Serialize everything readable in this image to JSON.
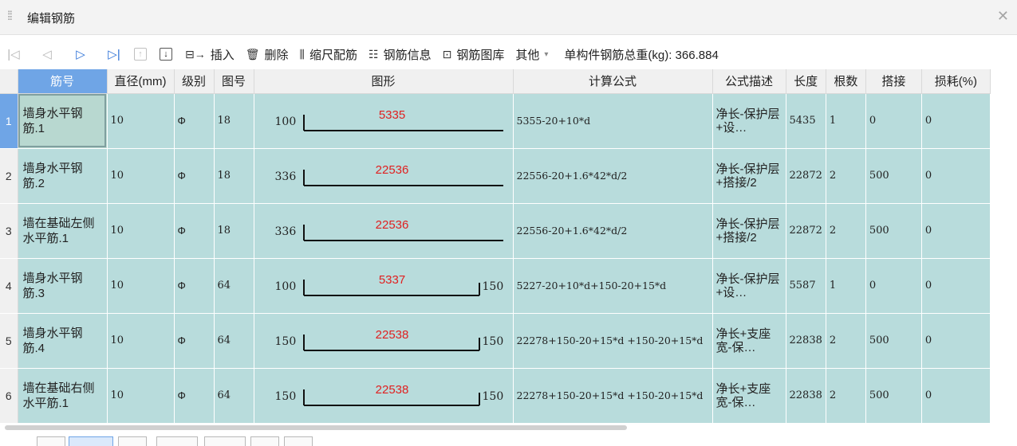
{
  "window": {
    "title": "编辑钢筋"
  },
  "toolbar": {
    "insert_label": "插入",
    "delete_label": "删除",
    "scale_label": "缩尺配筋",
    "info_label": "钢筋信息",
    "library_label": "钢筋图库",
    "other_label": "其他",
    "weight_label": "单构件钢筋总重(kg): 366.884"
  },
  "headers": [
    "筋号",
    "直径(mm)",
    "级别",
    "图号",
    "图形",
    "计算公式",
    "公式描述",
    "长度",
    "根数",
    "搭接",
    "损耗(%)"
  ],
  "steel_grade_symbol": "Ф",
  "rows": [
    {
      "index": "1",
      "name": "墙身水平钢筋.1",
      "dia": "10",
      "fig": "18",
      "shape": "L",
      "left": "100",
      "length": "5335",
      "right": "",
      "formula": "5355-20+10*d",
      "desc": "净长-保护层+设…",
      "len": "5435",
      "count": "1",
      "lap": "0",
      "loss": "0"
    },
    {
      "index": "2",
      "name": "墙身水平钢筋.2",
      "dia": "10",
      "fig": "18",
      "shape": "L",
      "left": "336",
      "length": "22536",
      "right": "",
      "formula": "22556-20+1.6*42*d/2",
      "desc": "净长-保护层+搭接/2",
      "len": "22872",
      "count": "2",
      "lap": "500",
      "loss": "0"
    },
    {
      "index": "3",
      "name": "墙在基础左侧水平筋.1",
      "dia": "10",
      "fig": "18",
      "shape": "L",
      "left": "336",
      "length": "22536",
      "right": "",
      "formula": "22556-20+1.6*42*d/2",
      "desc": "净长-保护层+搭接/2",
      "len": "22872",
      "count": "2",
      "lap": "500",
      "loss": "0"
    },
    {
      "index": "4",
      "name": "墙身水平钢筋.3",
      "dia": "10",
      "fig": "64",
      "shape": "U",
      "left": "100",
      "length": "5337",
      "right": "150",
      "formula": "5227-20+10*d+150-20+15*d",
      "desc": "净长-保护层+设…",
      "len": "5587",
      "count": "1",
      "lap": "0",
      "loss": "0"
    },
    {
      "index": "5",
      "name": "墙身水平钢筋.4",
      "dia": "10",
      "fig": "64",
      "shape": "U",
      "left": "150",
      "length": "22538",
      "right": "150",
      "formula": "22278+150-20+15*d +150-20+15*d",
      "desc": "净长+支座宽-保…",
      "len": "22838",
      "count": "2",
      "lap": "500",
      "loss": "0"
    },
    {
      "index": "6",
      "name": "墙在基础右侧水平筋.1",
      "dia": "10",
      "fig": "64",
      "shape": "U",
      "left": "150",
      "length": "22538",
      "right": "150",
      "formula": "22278+150-20+15*d +150-20+15*d",
      "desc": "净长+支座宽-保…",
      "len": "22838",
      "count": "2",
      "lap": "500",
      "loss": "0"
    }
  ]
}
